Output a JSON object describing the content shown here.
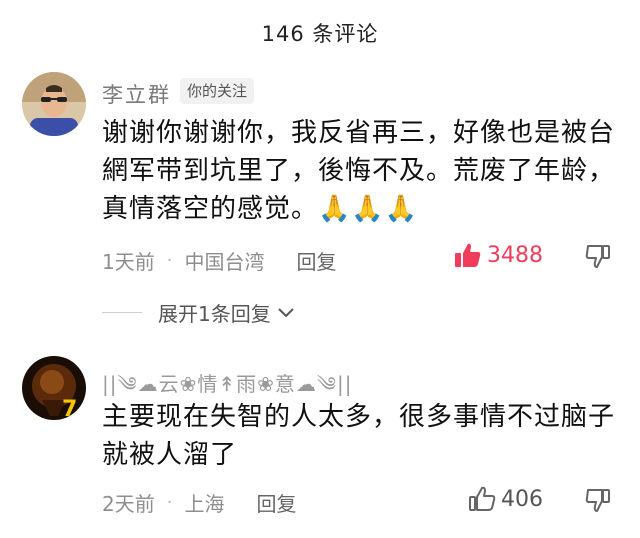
{
  "header": {
    "title": "146 条评论"
  },
  "comments": [
    {
      "username": "李立群",
      "badge": "你的关注",
      "text_lines": [
        "谢谢你谢谢你，我反省再三，好像也是被台",
        "網军带到坑里了，後悔不及。荒废了年龄，",
        "真情落空的感觉。🙏🙏🙏"
      ],
      "time": "1天前",
      "location": "中国台湾",
      "reply_label": "回复",
      "likes": "3488",
      "liked": true,
      "expand_label": "展开1条回复"
    },
    {
      "username": "||༄☁云❀情↟雨❀意☁༄||",
      "text_lines": [
        "主要现在失智的人太多，很多事情不过脑子",
        "就被人溜了"
      ],
      "time": "2天前",
      "location": "上海",
      "reply_label": "回复",
      "likes": "406",
      "liked": false
    }
  ],
  "colors": {
    "accent_like": "#f23c5c",
    "meta_gray": "#8e8e8e"
  },
  "icons": [
    "thumbs-up-icon",
    "thumbs-down-icon",
    "chevron-down-icon",
    "pray-emoji"
  ]
}
